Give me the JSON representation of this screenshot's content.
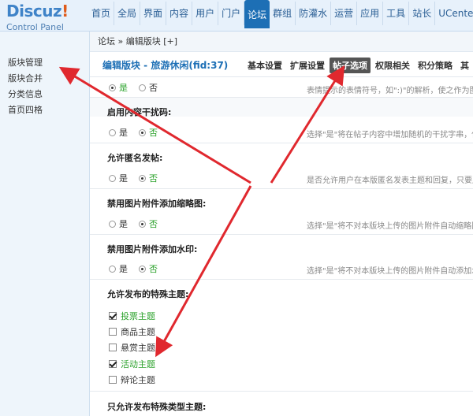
{
  "logo": {
    "brand": "Discuz",
    "bang": "!",
    "subtitle": "Control Panel"
  },
  "nav": [
    "首页",
    "全局",
    "界面",
    "内容",
    "用户",
    "门户",
    "论坛",
    "群组",
    "防灌水",
    "运营",
    "应用",
    "工具",
    "站长",
    "UCenter"
  ],
  "sidebar": [
    "版块管理",
    "版块合并",
    "分类信息",
    "首页四格"
  ],
  "breadcrumb": "论坛 » 编辑版块 [+]",
  "page_title": "编辑版块 - 旅游休闲(fid:37)",
  "subtabs": [
    "基本设置",
    "扩展设置",
    "帖子选项",
    "权限相关",
    "积分策略",
    "其"
  ],
  "options": {
    "yes": "是",
    "no": "否"
  },
  "settings": {
    "first_desc": "表情提示的表情符号，如\":)\"的解析，使之作为图",
    "interference": {
      "label": "启用内容干扰码:",
      "desc": "选择\"是\"将在帖子内容中增加随机的干扰字串，使"
    },
    "anonymous": {
      "label": "允许匿名发帖:",
      "desc": "是否允许用户在本版匿名发表主题和回复，只要用"
    },
    "thumb": {
      "label": "禁用图片附件添加缩略图:",
      "desc": "选择\"是\"将不对本版块上传的图片附件自动缩略图"
    },
    "watermark": {
      "label": "禁用图片附件添加水印:",
      "desc": "选择\"是\"将不对本版块上传的图片附件自动添加水"
    },
    "special": {
      "label": "允许发布的特殊主题:"
    },
    "special_only": {
      "label": "只允许发布特殊类型主题:"
    }
  },
  "special_types": [
    {
      "label": "投票主题",
      "checked": true,
      "green": true
    },
    {
      "label": "商品主题",
      "checked": false,
      "green": false
    },
    {
      "label": "悬赏主题",
      "checked": false,
      "green": false
    },
    {
      "label": "活动主题",
      "checked": true,
      "green": true
    },
    {
      "label": "辩论主题",
      "checked": false,
      "green": false
    }
  ],
  "colors": {
    "accent": "#1d6fb5",
    "arrow": "#e0282e",
    "green": "#2aa12a"
  }
}
